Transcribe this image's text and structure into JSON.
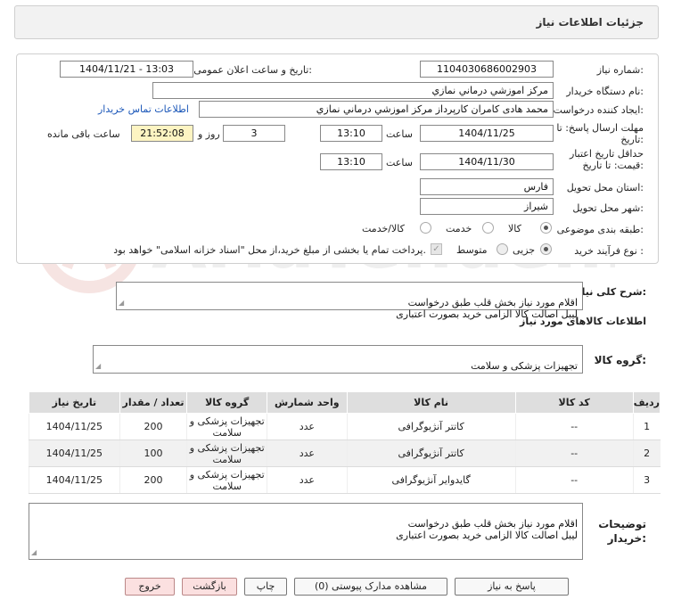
{
  "window": {
    "title": "جزئیات اطلاعات نیاز"
  },
  "form": {
    "need_number_label": "شماره نیاز:",
    "need_number": "1104030686002903",
    "announce_label": "تاریخ و ساعت اعلان عمومی:",
    "announce_value": "1404/11/21 - 13:03",
    "buyer_org_label": "نام دستگاه خریدار:",
    "buyer_org": "مرکز اموزشي درماني نمازي",
    "creator_label": "ایجاد کننده درخواست:",
    "creator": "محمد هادی کامران کارپرداز مرکز اموزشي درماني نمازي",
    "contact_link": "اطلاعات تماس خریدار",
    "reply_deadline_label": "مهلت ارسال پاسخ: تا تاریخ:",
    "reply_date": "1404/11/25",
    "time_label": "ساعت",
    "reply_time": "13:10",
    "days": "3",
    "days_label": "روز و",
    "remaining": "21:52:08",
    "remaining_label": "ساعت باقی مانده",
    "validity_label": "حداقل تاریخ اعتبار قیمت: تا تاریخ:",
    "validity_date": "1404/11/30",
    "validity_time": "13:10",
    "province_label": "استان محل تحویل:",
    "province": "فارس",
    "city_label": "شهر محل تحویل:",
    "city": "شیراز",
    "category_label": "طبقه بندی موضوعی:",
    "category_options": [
      "کالا",
      "خدمت",
      "کالا/خدمت"
    ],
    "category_selected": "کالا",
    "process_label": "نوع فرآیند خرید :",
    "process_options": [
      "جزیی",
      "متوسط"
    ],
    "process_selected": "جزیی",
    "payment_note": "پرداخت تمام یا بخشی از مبلغ خرید،از محل \"اسناد خزانه اسلامی\" خواهد بود."
  },
  "general_desc": {
    "label": "شرح کلی نیاز:",
    "text": "اقلام مورد نیاز بخش قلب طبق درخواست\nلیبل اصالت کالا الزامی خرید بصورت اعتباری"
  },
  "goods_info": {
    "heading": "اطلاعات کالاهای مورد نیاز",
    "group_label": "گروه کالا:",
    "group_value": "تجهیزات پزشکی و سلامت"
  },
  "table": {
    "columns": [
      "ردیف",
      "کد کالا",
      "نام کالا",
      "واحد شمارش",
      "گروه کالا",
      "تعداد / مقدار",
      "تاریخ نیاز"
    ],
    "rows": [
      [
        "1",
        "--",
        "کاتتر آنژیوگرافی",
        "عدد",
        "تجهیزات پزشکی و سلامت",
        "200",
        "1404/11/25"
      ],
      [
        "2",
        "--",
        "کاتتر آنژیوگرافی",
        "عدد",
        "تجهیزات پزشکی و سلامت",
        "100",
        "1404/11/25"
      ],
      [
        "3",
        "--",
        "گایدوایر آنژیوگرافی",
        "عدد",
        "تجهیزات پزشکی و سلامت",
        "200",
        "1404/11/25"
      ]
    ]
  },
  "buyer_notes": {
    "label": "توضیحات خریدار:",
    "text": "اقلام مورد نیاز بخش قلب طبق درخواست\nلیبل اصالت کالا الزامی خرید بصورت اعتباری"
  },
  "buttons": {
    "reply": "پاسخ به نیاز",
    "attachments": "مشاهده مدارک پیوستی (0)",
    "print": "چاپ",
    "back": "بازگشت",
    "exit": "خروج"
  },
  "watermark": {
    "text": "AriaTender.net"
  },
  "colors": {
    "link": "#1a56b8",
    "highlight": "#fdf4c2",
    "header_bg": "#dedede"
  }
}
